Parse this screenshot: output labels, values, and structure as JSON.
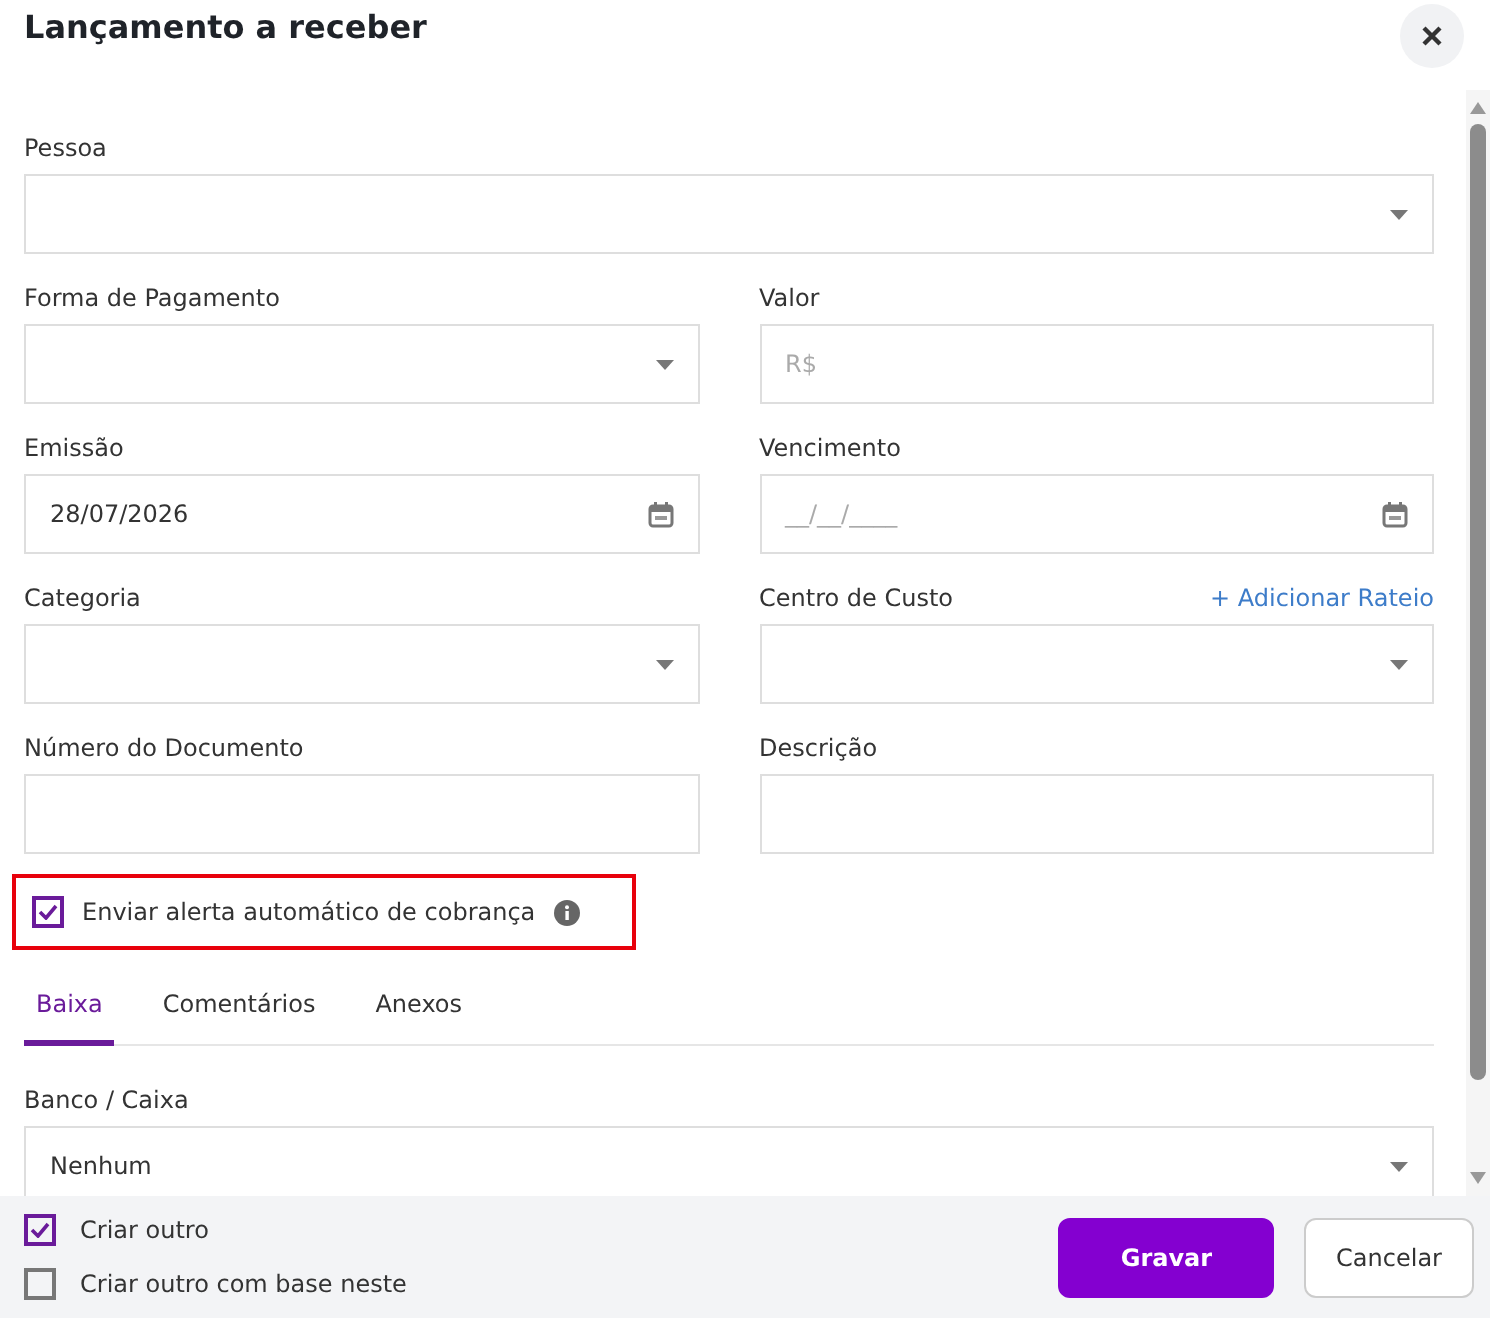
{
  "title": "Lançamento a receber",
  "rows": [
    [
      {
        "label": "Pessoa",
        "kind": "select"
      }
    ],
    [
      {
        "label": "Forma de Pagamento",
        "kind": "select"
      },
      {
        "label": "Valor",
        "kind": "text",
        "placeholder": "R$"
      }
    ],
    [
      {
        "label": "Emissão",
        "kind": "date",
        "value": "28/07/2026"
      },
      {
        "label": "Vencimento",
        "kind": "date",
        "placeholder": "__/__/____"
      }
    ],
    [
      {
        "label": "Categoria",
        "kind": "select"
      },
      {
        "label": "Centro de Custo",
        "kind": "select",
        "action": "+ Adicionar Rateio"
      }
    ],
    [
      {
        "label": "Número do Documento",
        "kind": "text"
      },
      {
        "label": "Descrição",
        "kind": "text"
      }
    ]
  ],
  "alert": {
    "label": "Enviar alerta automático de cobrança",
    "checked": true,
    "highlighted": true
  },
  "tabs": [
    {
      "label": "Baixa",
      "selected": true
    },
    {
      "label": "Comentários",
      "selected": false
    },
    {
      "label": "Anexos",
      "selected": false
    }
  ],
  "bank": {
    "label": "Banco / Caixa",
    "value": "Nenhum"
  },
  "footer_options": [
    {
      "label": "Criar outro",
      "checked": true
    },
    {
      "label": "Criar outro com base neste",
      "checked": false
    }
  ],
  "buttons": [
    {
      "label": "Gravar",
      "kind": "primary"
    },
    {
      "label": "Cancelar",
      "kind": "secondary"
    }
  ]
}
